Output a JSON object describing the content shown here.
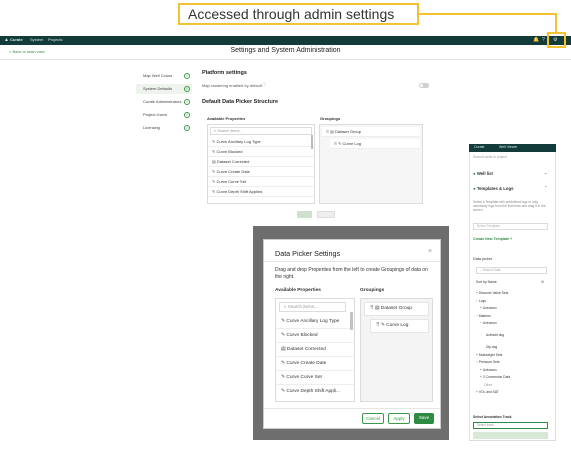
{
  "callout": {
    "text": "Accessed through admin settings",
    "color": "#f2c230"
  },
  "topbar": {
    "brand": "Curate",
    "nav": [
      "System",
      "Projects"
    ],
    "bell_icon": "bell-icon",
    "help_icon": "help-icon",
    "gear_icon": "gear-icon",
    "bg_color": "#123b3a"
  },
  "header": {
    "back_label": "< Back to main view",
    "title": "Settings and System Administration"
  },
  "nav": {
    "items": [
      {
        "label": "Map Well Colors"
      },
      {
        "label": "System Defaults"
      },
      {
        "label": "Curate Administrators"
      },
      {
        "label": "Project Users"
      },
      {
        "label": "Licensing"
      }
    ]
  },
  "platform": {
    "title": "Platform settings",
    "map_clustering_label": "Map clustering enabled by default"
  },
  "picker": {
    "title": "Default Data Picker Structure",
    "available_label": "Available Properties",
    "groupings_label": "Groupings",
    "search_placeholder": "Search items...",
    "available": [
      "Curve Ancillary Log Type",
      "Curve Blocked",
      "Dataset Corrected",
      "Curve Create Date",
      "Curve Curve Set",
      "Curve Depth Shift Applied"
    ],
    "groupings": [
      "Dataset Group",
      "Curve Log"
    ]
  },
  "right_panel": {
    "header_brand": "Curate",
    "header_tab": "Well Viewer",
    "search_placeholder": "Search wells in project",
    "well_list": "Well list",
    "templates": "Templates & Logs",
    "templates_desc": "Select a Template with predefined logs or only necessary logs from the list below and drag it to the screen.",
    "select_template": "Select Template",
    "create_template": "Create New Template +",
    "data_picker": "Data picker",
    "data_search": "Search Data",
    "sort_label": "Sort by Name",
    "tree": [
      "Discover Value Sets",
      "Logs",
      "Unknown",
      "Markers",
      "Unknown",
      "Azimuth.dcg",
      "Dip.dcg",
      "Mudweight Sets",
      "Pressure Sets",
      "Unknown",
      "2 Conversion Data",
      "Other",
      "VOL and SAT"
    ],
    "annotation_label": "Select Annotation Track",
    "annotation_value": "Select track"
  },
  "modal": {
    "title": "Data Picker Settings",
    "description": "Drag and drop Properties from the left to create Groupings of data on the right.",
    "available_label": "Available Properties",
    "groupings_label": "Groupings",
    "search_placeholder": "Search items...",
    "available": [
      "Curve Ancillary Log Type",
      "Curve Blocked",
      "Dataset Corrected",
      "Curve Create Date",
      "Curve Curve Set",
      "Curve Depth Shift Appli..."
    ],
    "groupings": [
      "Dataset Group",
      "Curve Log"
    ],
    "cancel": "Cancel",
    "apply": "Apply",
    "save": "Save"
  }
}
